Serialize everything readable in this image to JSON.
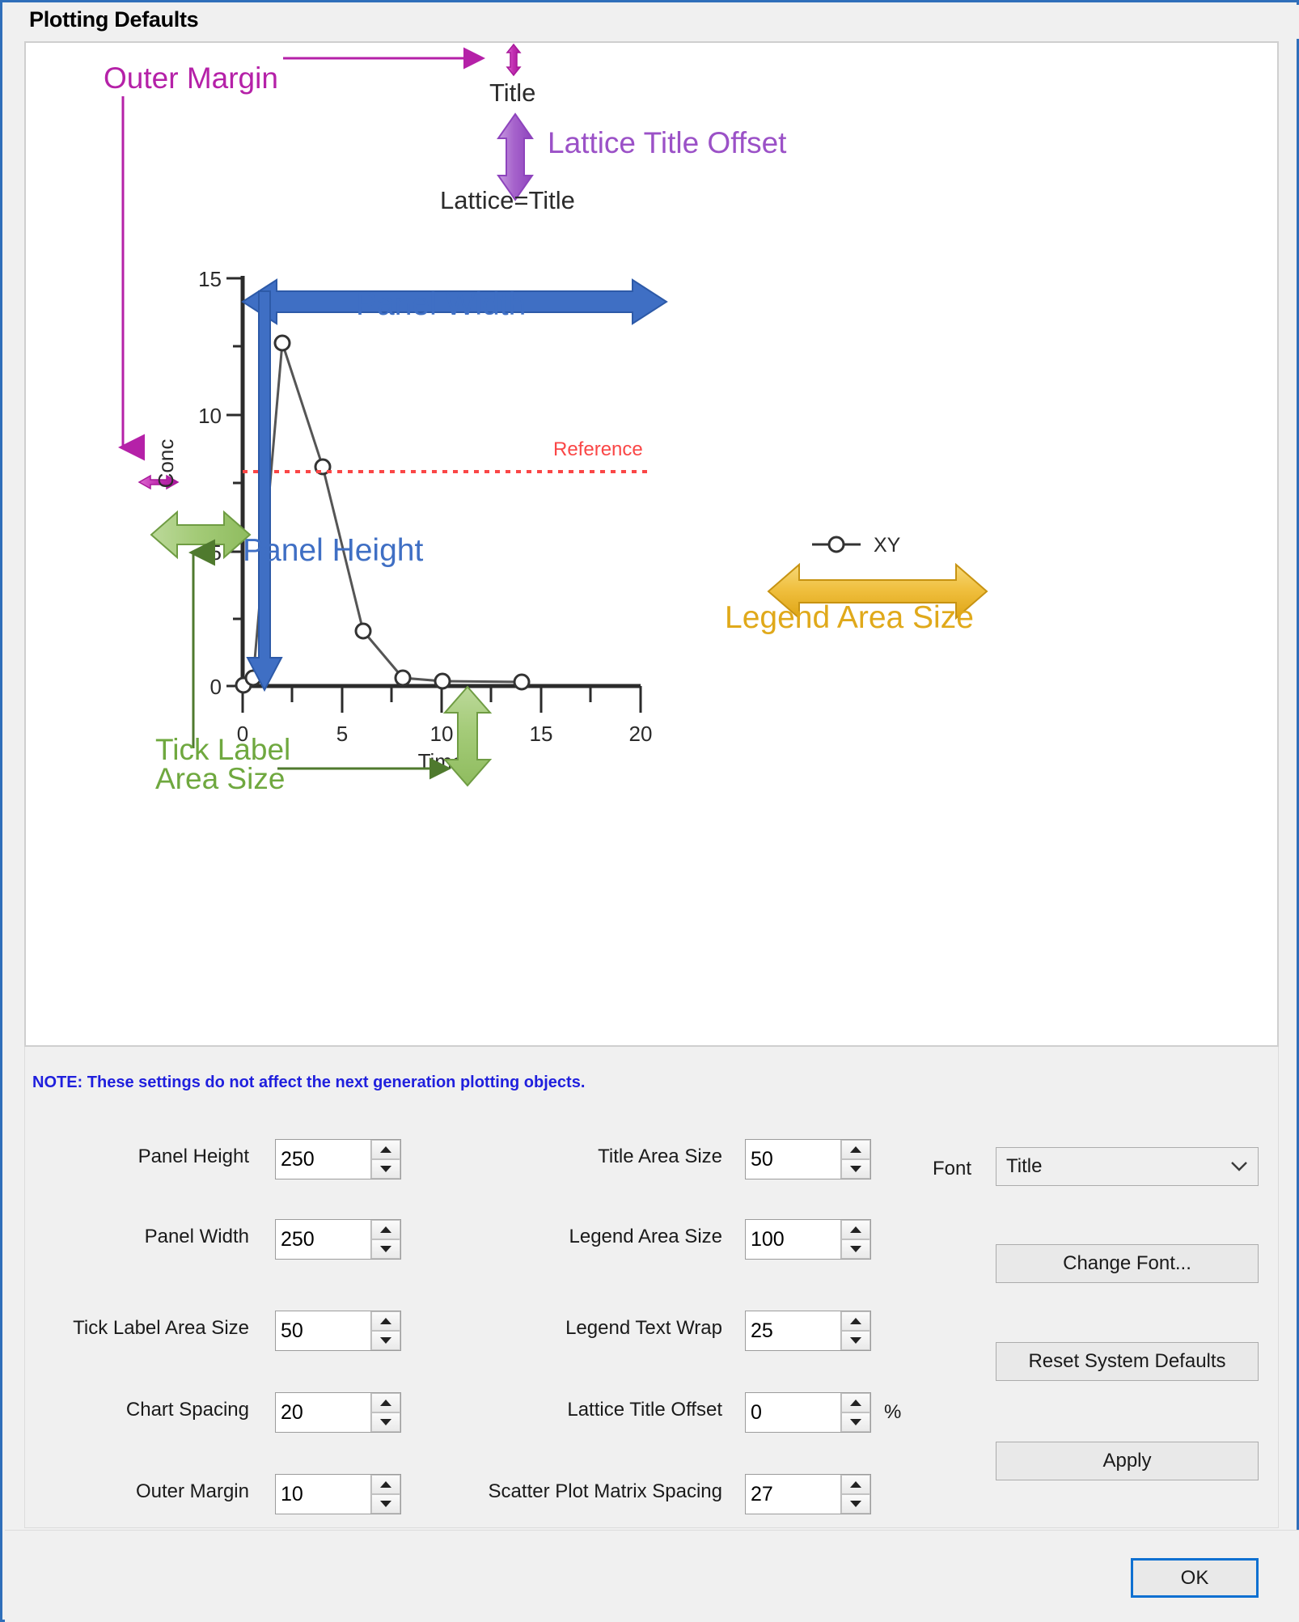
{
  "window": {
    "title": "Plotting Defaults"
  },
  "illustration": {
    "annotations": {
      "outer_margin": "Outer Margin",
      "title": "Title",
      "lattice_title": "Lattice=Title",
      "lattice_title_offset": "Lattice Title Offset",
      "panel_width": "Panel Width",
      "panel_height": "Panel Height",
      "tick_label_area_size_line1": "Tick Label",
      "tick_label_area_size_line2": "Area Size",
      "legend_area_size": "Legend Area Size",
      "reference": "Reference",
      "legend_entry": "XY"
    },
    "colors": {
      "outer_margin": "#b521a8",
      "lattice_offset": "#9b51c7",
      "panel_blue": "#3f6fc4",
      "tick_label_green": "#6fa83f",
      "legend_gold": "#e0a91a",
      "reference_red": "#fa4646",
      "axis_black": "#2b2b2b"
    }
  },
  "chart_data": {
    "type": "line",
    "title": "Title",
    "xlabel": "Time",
    "ylabel": "Conc",
    "x": [
      0,
      0.5,
      2,
      4,
      6,
      8,
      12,
      16
    ],
    "y": [
      0.1,
      0.3,
      12.5,
      8.0,
      2.0,
      0.3,
      0.15,
      0.12
    ],
    "series": [
      {
        "name": "XY",
        "values": [
          0.1,
          0.3,
          12.5,
          8.0,
          2.0,
          0.3,
          0.15,
          0.12
        ]
      }
    ],
    "xlim": [
      0,
      20
    ],
    "ylim": [
      0,
      15
    ],
    "xticks": [
      0,
      5,
      10,
      15,
      20
    ],
    "yticks": [
      0,
      5,
      10,
      15
    ],
    "x_minor_ticks": [
      2.5,
      7.5,
      12.5,
      17.5
    ],
    "y_minor_ticks": [
      2.5,
      7.5,
      12.5
    ],
    "reference_line": {
      "label": "Reference",
      "y": 8.0,
      "style": "dotted",
      "color": "#fa4646"
    },
    "grid": false,
    "legend": {
      "position": "right",
      "entries": [
        "XY"
      ]
    },
    "marker": "open-circle",
    "line_color": "#555555"
  },
  "settings": {
    "note": "NOTE: These settings do not affect the next generation plotting objects.",
    "left_fields": [
      {
        "label": "Panel Height",
        "value": "250"
      },
      {
        "label": "Panel Width",
        "value": "250"
      },
      {
        "label": "Tick Label Area Size",
        "value": "50"
      },
      {
        "label": "Chart Spacing",
        "value": "20"
      },
      {
        "label": "Outer Margin",
        "value": "10"
      }
    ],
    "middle_fields": [
      {
        "label": "Title Area Size",
        "value": "50",
        "suffix": ""
      },
      {
        "label": "Legend Area Size",
        "value": "100",
        "suffix": ""
      },
      {
        "label": "Legend Text Wrap",
        "value": "25",
        "suffix": ""
      },
      {
        "label": "Lattice Title Offset",
        "value": "0",
        "suffix": "%"
      },
      {
        "label": "Scatter Plot Matrix Spacing",
        "value": "27",
        "suffix": ""
      }
    ],
    "font": {
      "label": "Font",
      "selected": "Title"
    },
    "buttons": {
      "change_font": "Change Font...",
      "reset_system_defaults": "Reset System Defaults",
      "apply": "Apply"
    }
  },
  "footer": {
    "ok": "OK"
  }
}
